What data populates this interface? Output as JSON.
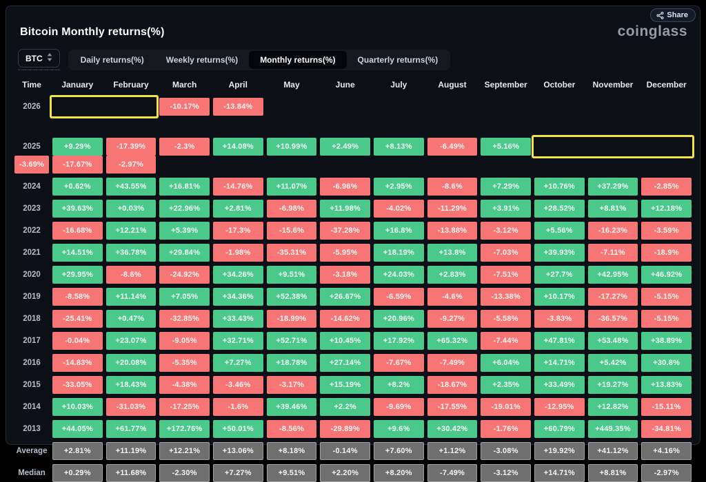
{
  "header": {
    "title": "Bitcoin Monthly returns(%)",
    "logo": "coinglass",
    "share_label": "Share"
  },
  "toolbar": {
    "coin_select": "BTC",
    "tabs": [
      {
        "label": "Daily returns(%)",
        "active": false
      },
      {
        "label": "Weekly returns(%)",
        "active": false
      },
      {
        "label": "Monthly returns(%)",
        "active": true
      },
      {
        "label": "Quarterly returns(%)",
        "active": false
      }
    ]
  },
  "colors": {
    "positive": "#4ac98b",
    "negative": "#f87575",
    "neutral": "#6f6f6f",
    "highlight": "#f3e53d"
  },
  "chart_data": {
    "type": "heatmap",
    "title": "Bitcoin Monthly returns(%)",
    "columns": [
      "Time",
      "January",
      "February",
      "March",
      "April",
      "May",
      "June",
      "July",
      "August",
      "September",
      "October",
      "November",
      "December"
    ],
    "rows": [
      {
        "label": "2026",
        "kind": "year",
        "values": [
          "-10.17%",
          "-13.84%",
          "",
          "",
          "",
          "",
          "",
          "",
          "",
          "",
          "",
          ""
        ]
      },
      {
        "label": "2025",
        "kind": "year",
        "values": [
          "+9.29%",
          "-17.39%",
          "-2.3%",
          "+14.08%",
          "+10.99%",
          "+2.49%",
          "+8.13%",
          "-6.49%",
          "+5.16%",
          "-3.69%",
          "-17.67%",
          "-2.97%"
        ]
      },
      {
        "label": "2024",
        "kind": "year",
        "values": [
          "+0.62%",
          "+43.55%",
          "+16.81%",
          "-14.76%",
          "+11.07%",
          "-6.96%",
          "+2.95%",
          "-8.6%",
          "+7.29%",
          "+10.76%",
          "+37.29%",
          "-2.85%"
        ]
      },
      {
        "label": "2023",
        "kind": "year",
        "values": [
          "+39.63%",
          "+0.03%",
          "+22.96%",
          "+2.81%",
          "-6.98%",
          "+11.98%",
          "-4.02%",
          "-11.29%",
          "+3.91%",
          "+28.52%",
          "+8.81%",
          "+12.18%"
        ]
      },
      {
        "label": "2022",
        "kind": "year",
        "values": [
          "-16.68%",
          "+12.21%",
          "+5.39%",
          "-17.3%",
          "-15.6%",
          "-37.28%",
          "+16.8%",
          "-13.88%",
          "-3.12%",
          "+5.56%",
          "-16.23%",
          "-3.59%"
        ]
      },
      {
        "label": "2021",
        "kind": "year",
        "values": [
          "+14.51%",
          "+36.78%",
          "+29.84%",
          "-1.98%",
          "-35.31%",
          "-5.95%",
          "+18.19%",
          "+13.8%",
          "-7.03%",
          "+39.93%",
          "-7.11%",
          "-18.9%"
        ]
      },
      {
        "label": "2020",
        "kind": "year",
        "values": [
          "+29.95%",
          "-8.6%",
          "-24.92%",
          "+34.26%",
          "+9.51%",
          "-3.18%",
          "+24.03%",
          "+2.83%",
          "-7.51%",
          "+27.7%",
          "+42.95%",
          "+46.92%"
        ]
      },
      {
        "label": "2019",
        "kind": "year",
        "values": [
          "-8.58%",
          "+11.14%",
          "+7.05%",
          "+34.36%",
          "+52.38%",
          "+26.67%",
          "-6.59%",
          "-4.6%",
          "-13.38%",
          "+10.17%",
          "-17.27%",
          "-5.15%"
        ]
      },
      {
        "label": "2018",
        "kind": "year",
        "values": [
          "-25.41%",
          "+0.47%",
          "-32.85%",
          "+33.43%",
          "-18.99%",
          "-14.62%",
          "+20.96%",
          "-9.27%",
          "-5.58%",
          "-3.83%",
          "-36.57%",
          "-5.15%"
        ]
      },
      {
        "label": "2017",
        "kind": "year",
        "values": [
          "-0.04%",
          "+23.07%",
          "-9.05%",
          "+32.71%",
          "+52.71%",
          "+10.45%",
          "+17.92%",
          "+65.32%",
          "-7.44%",
          "+47.81%",
          "+53.48%",
          "+38.89%"
        ]
      },
      {
        "label": "2016",
        "kind": "year",
        "values": [
          "-14.83%",
          "+20.08%",
          "-5.35%",
          "+7.27%",
          "+18.78%",
          "+27.14%",
          "-7.67%",
          "-7.49%",
          "+6.04%",
          "+14.71%",
          "+5.42%",
          "+30.8%"
        ]
      },
      {
        "label": "2015",
        "kind": "year",
        "values": [
          "-33.05%",
          "+18.43%",
          "-4.38%",
          "-3.46%",
          "-3.17%",
          "+15.19%",
          "+8.2%",
          "-18.67%",
          "+2.35%",
          "+33.49%",
          "+19.27%",
          "+13.83%"
        ]
      },
      {
        "label": "2014",
        "kind": "year",
        "values": [
          "+10.03%",
          "-31.03%",
          "-17.25%",
          "-1.6%",
          "+39.46%",
          "+2.2%",
          "-9.69%",
          "-17.55%",
          "-19.01%",
          "-12.95%",
          "+12.82%",
          "-15.11%"
        ]
      },
      {
        "label": "2013",
        "kind": "year",
        "values": [
          "+44.05%",
          "+61.77%",
          "+172.76%",
          "+50.01%",
          "-8.56%",
          "-29.89%",
          "+9.6%",
          "+30.42%",
          "-1.76%",
          "+60.79%",
          "+449.35%",
          "-34.81%"
        ]
      },
      {
        "label": "Average",
        "kind": "stat",
        "values": [
          "+2.81%",
          "+11.19%",
          "+12.21%",
          "+13.06%",
          "+8.18%",
          "-0.14%",
          "+7.60%",
          "+1.12%",
          "-3.08%",
          "+19.92%",
          "+41.12%",
          "+4.16%"
        ]
      },
      {
        "label": "Median",
        "kind": "stat",
        "values": [
          "+0.29%",
          "+11.68%",
          "-2.30%",
          "+7.27%",
          "+9.51%",
          "+2.20%",
          "+8.20%",
          "-7.49%",
          "-3.12%",
          "+14.71%",
          "+8.81%",
          "-2.97%"
        ]
      }
    ],
    "highlights": [
      {
        "row_label": "2026",
        "col_start": 0,
        "col_end": 1
      },
      {
        "row_label": "2025",
        "col_start": 9,
        "col_end": 11
      }
    ]
  }
}
